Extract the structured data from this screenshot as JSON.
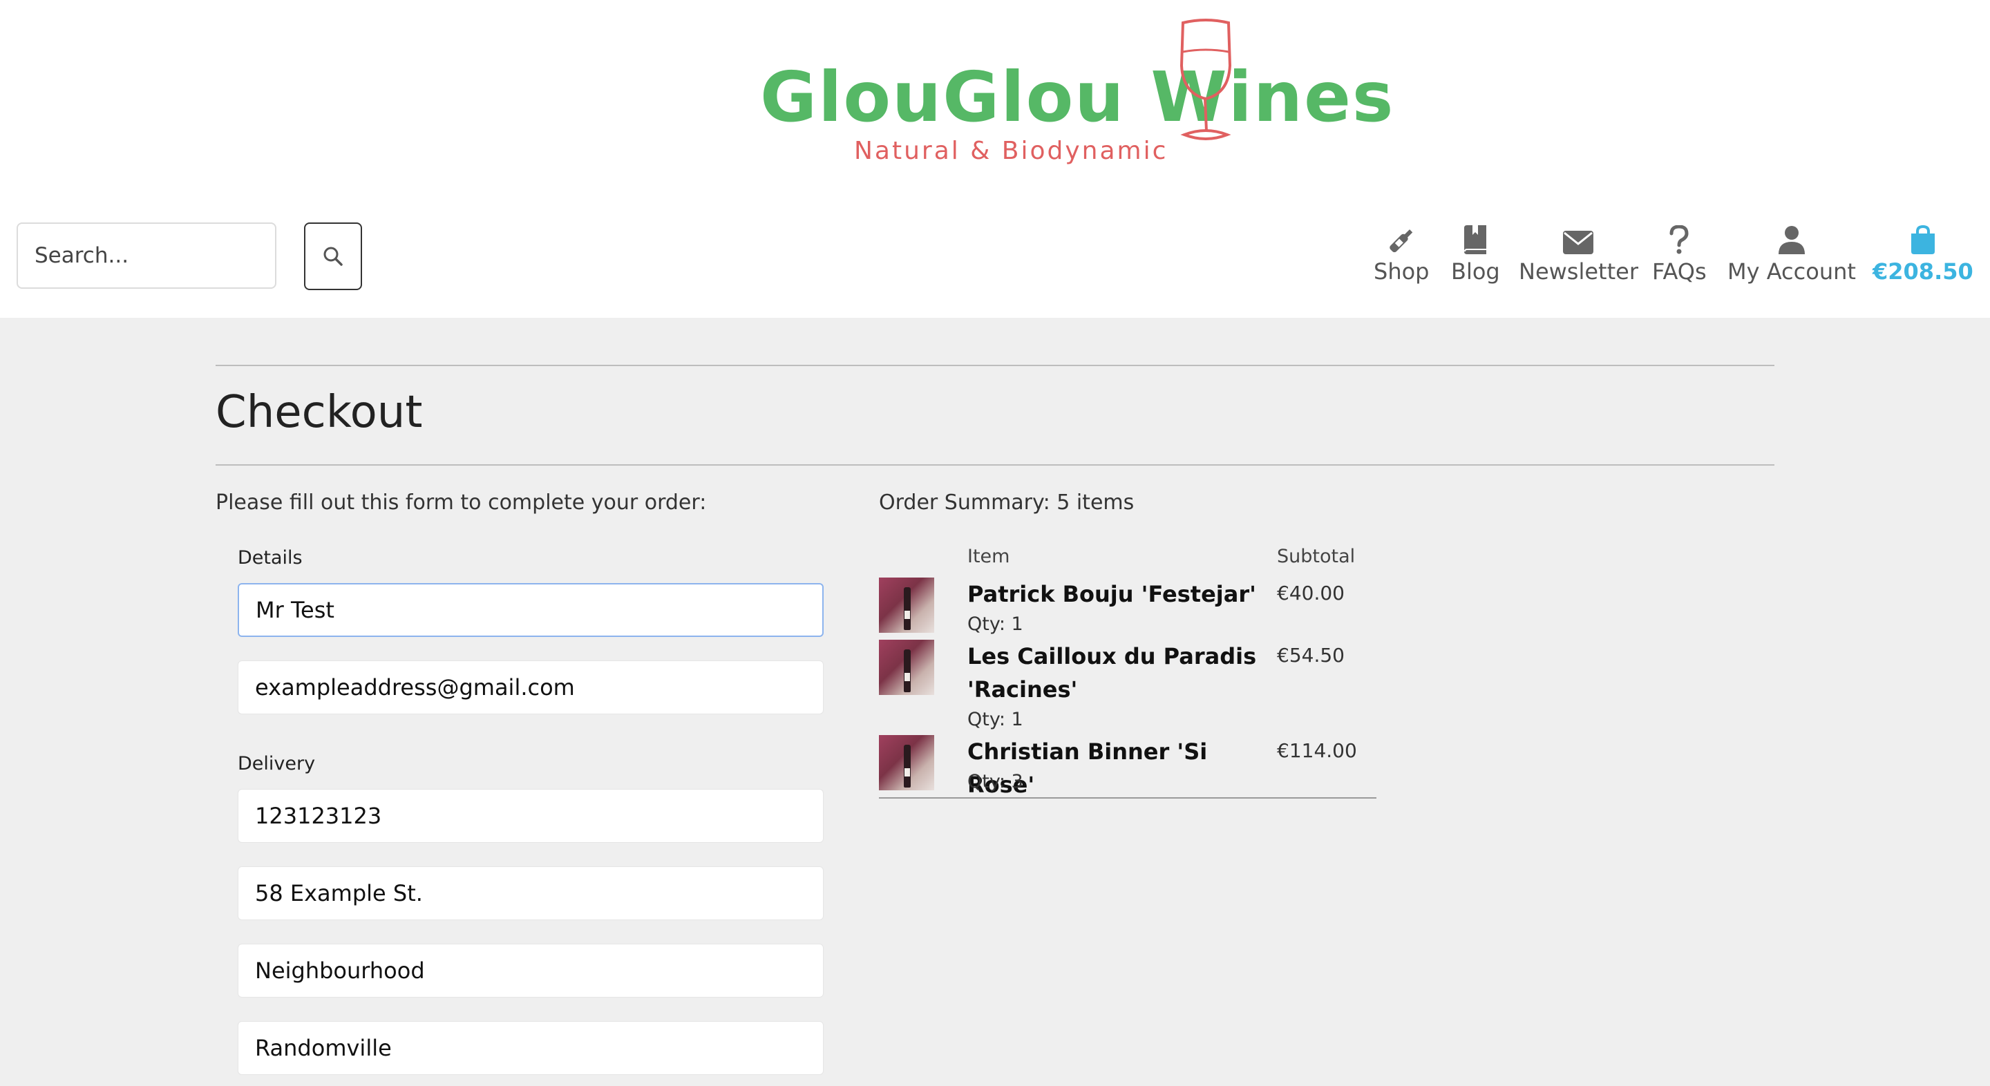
{
  "brand": {
    "name": "GlouGlou Wines",
    "tagline": "Natural & Biodynamic",
    "colors": {
      "name": "#56b866",
      "tagline": "#e06060"
    }
  },
  "search": {
    "placeholder": "Search...",
    "value": ""
  },
  "nav": {
    "items": [
      {
        "label": "Shop",
        "icon": "wine-bottle-icon"
      },
      {
        "label": "Blog",
        "icon": "book-icon"
      },
      {
        "label": "Newsletter",
        "icon": "envelope-icon"
      },
      {
        "label": "FAQs",
        "icon": "question-icon"
      },
      {
        "label": "My Account",
        "icon": "user-icon"
      }
    ],
    "cart": {
      "label": "€208.50",
      "icon": "shopping-bag-icon",
      "color": "#3cb4e0"
    }
  },
  "page": {
    "title": "Checkout",
    "intro": "Please fill out this form to complete your order:"
  },
  "form": {
    "details_label": "Details",
    "full_name": "Mr Test",
    "email": "exampleaddress@gmail.com",
    "delivery_label": "Delivery",
    "phone": "123123123",
    "street": "58 Example St.",
    "neighbourhood": "Neighbourhood",
    "town": "Randomville"
  },
  "summary": {
    "title": "Order Summary: 5 items",
    "col_item": "Item",
    "col_subtotal": "Subtotal",
    "items": [
      {
        "name": "Patrick Bouju 'Festejar'",
        "qty": "Qty: 1",
        "subtotal": "€40.00"
      },
      {
        "name": "Les Cailloux du Paradis 'Racines'",
        "qty": "Qty: 1",
        "subtotal": "€54.50"
      },
      {
        "name": "Christian Binner 'Si Rose'",
        "qty": "Qty: 3",
        "subtotal": "€114.00"
      }
    ]
  }
}
